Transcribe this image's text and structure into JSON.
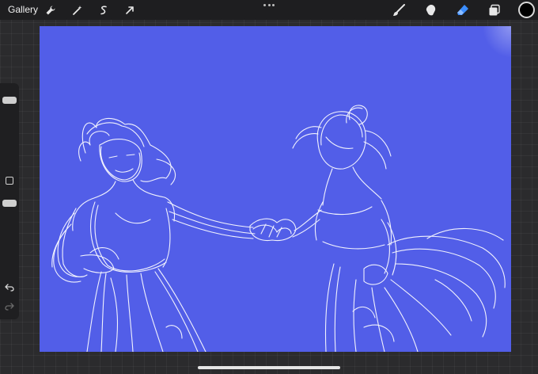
{
  "topbar": {
    "gallery_label": "Gallery",
    "left_tools": [
      "wrench-icon",
      "magic-wand-icon",
      "selection-icon",
      "transform-icon"
    ],
    "right_tools": [
      "brush-icon",
      "smudge-icon",
      "eraser-icon",
      "layers-icon"
    ],
    "active_tool": "eraser-icon",
    "current_color": "#000000",
    "active_color": "#3a8dff"
  },
  "canvas": {
    "background": "#525ee8",
    "stroke_color": "#ffffff"
  },
  "sidebar": {
    "items": [
      "brush-size-slider",
      "modify-button",
      "opacity-slider",
      "undo-icon",
      "redo-icon"
    ]
  }
}
